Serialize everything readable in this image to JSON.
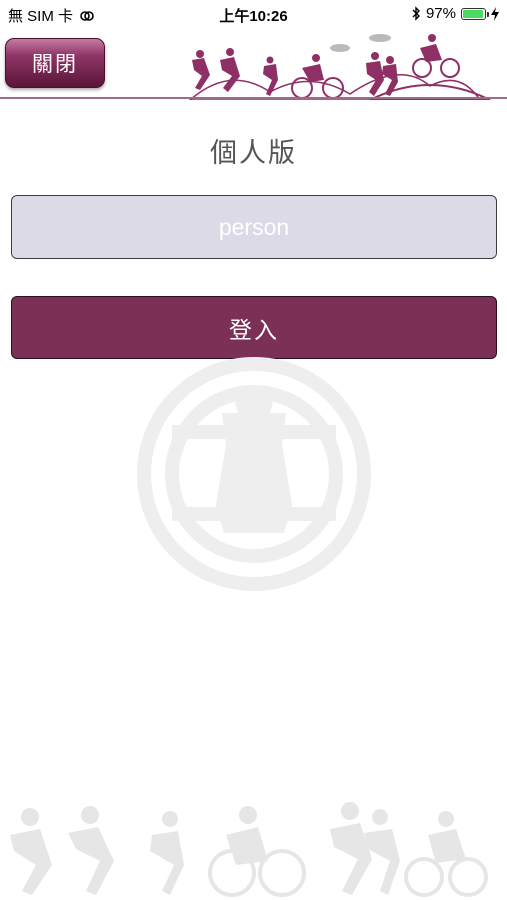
{
  "status_bar": {
    "carrier": "無 SIM 卡",
    "time": "上午10:26",
    "battery": "97%",
    "battery_level": 0.97
  },
  "header": {
    "close_label": "關閉"
  },
  "main": {
    "title": "個人版",
    "field_value": "person",
    "login_label": "登入"
  },
  "colors": {
    "brand": "#7b3055",
    "field_bg": "#dcdae6"
  }
}
